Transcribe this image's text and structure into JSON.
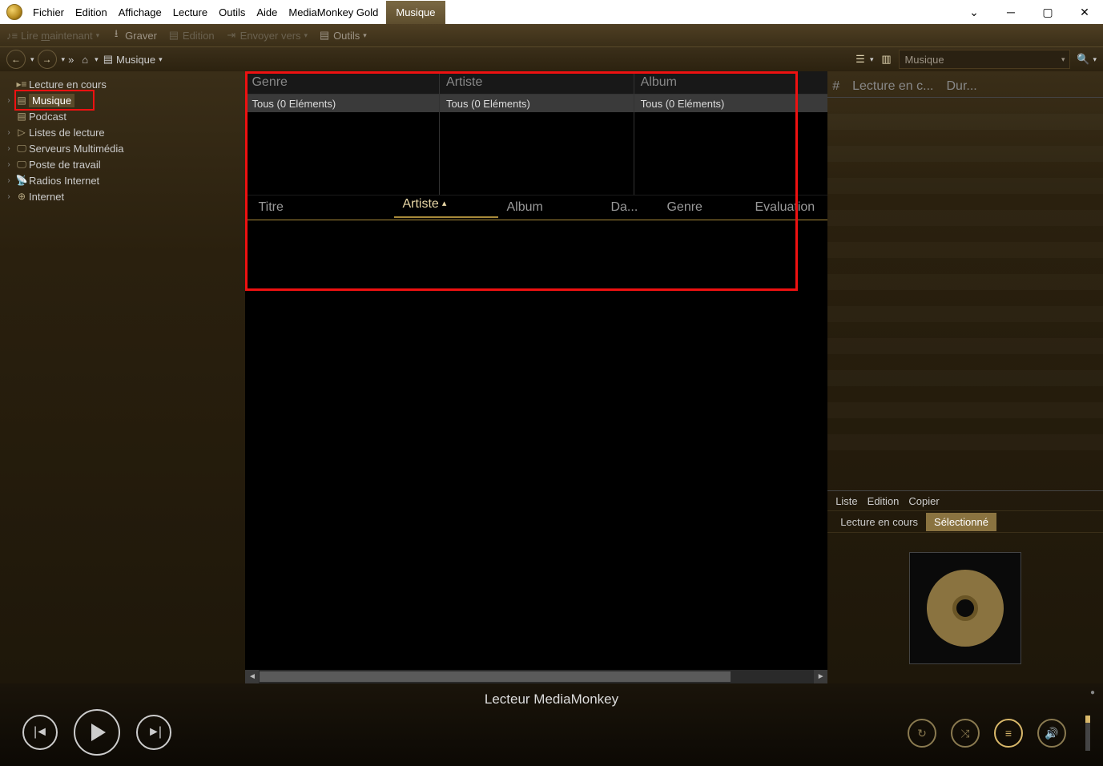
{
  "menu": {
    "fichier": "Fichier",
    "edition": "Edition",
    "affichage": "Affichage",
    "lecture": "Lecture",
    "outils": "Outils",
    "aide": "Aide",
    "gold": "MediaMonkey Gold",
    "tab": "Musique"
  },
  "toolbar": {
    "lire": "Lire maintenant",
    "graver": "Graver",
    "edition": "Edition",
    "envoyer": "Envoyer vers",
    "outils": "Outils"
  },
  "nav": {
    "crumb": "Musique",
    "combo": "Musique"
  },
  "tree": [
    {
      "label": "Lecture en cours",
      "exp": false
    },
    {
      "label": "Musique",
      "exp": true,
      "selected": true
    },
    {
      "label": "Podcast",
      "exp": false
    },
    {
      "label": "Listes de lecture",
      "exp": true
    },
    {
      "label": "Serveurs Multimédia",
      "exp": true
    },
    {
      "label": "Poste de travail",
      "exp": true
    },
    {
      "label": "Radios Internet",
      "exp": true
    },
    {
      "label": "Internet",
      "exp": true
    }
  ],
  "filters": {
    "genre": {
      "head": "Genre",
      "item": "Tous (0 Eléments)"
    },
    "artiste": {
      "head": "Artiste",
      "item": "Tous (0 Eléments)"
    },
    "album": {
      "head": "Album",
      "item": "Tous (0 Eléments)"
    }
  },
  "cols": {
    "titre": "Titre",
    "artiste": "Artiste",
    "album": "Album",
    "date": "Da...",
    "genre": "Genre",
    "eval": "Evaluation"
  },
  "right_cols": {
    "num": "#",
    "lec": "Lecture en c...",
    "dur": "Dur..."
  },
  "np": {
    "liste": "Liste",
    "edition": "Edition",
    "copier": "Copier",
    "tab1": "Lecture en cours",
    "tab2": "Sélectionné"
  },
  "player": {
    "title": "Lecteur MediaMonkey"
  },
  "underline": {
    "m": "m"
  }
}
